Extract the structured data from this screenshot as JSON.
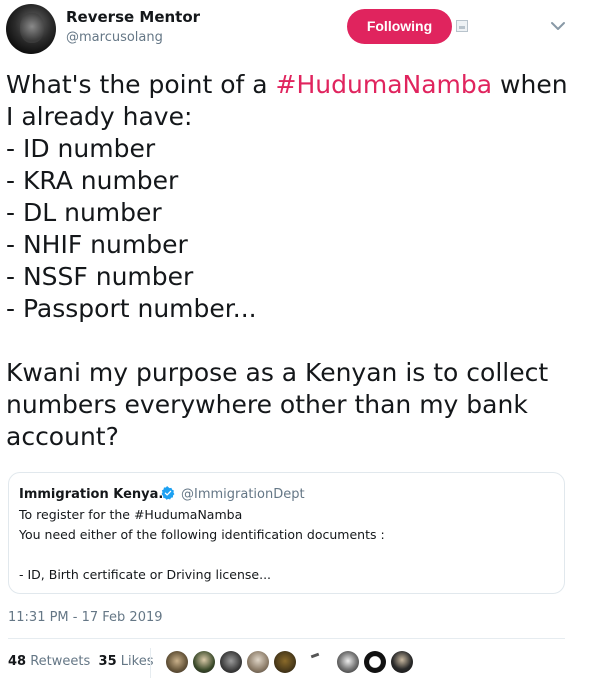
{
  "tweet": {
    "author": {
      "display_name": "Reverse Mentor",
      "handle": "@marcusolang"
    },
    "follow_button_label": "Following",
    "text_before": "What's the point of a ",
    "hashtag": "#HudumaNamba",
    "text_after": " when I already have:\n- ID number\n- KRA number\n- DL number\n- NHIF number\n- NSSF number\n- Passport number...\n\nKwani my purpose as a Kenyan is to collect numbers everywhere other than my bank account?",
    "quoted_tweet": {
      "author_name": "Immigration Kenya.",
      "author_handle": "@ImmigrationDept",
      "lines": [
        "To register for the #HudumaNamba",
        "You need either of the following identification documents :",
        "- ID, Birth certificate or Driving license..."
      ]
    },
    "timestamp": "11:31 PM - 17 Feb 2019",
    "stats": {
      "retweets_count": "48",
      "retweets_label": "Retweets",
      "likes_count": "35",
      "likes_label": "Likes"
    }
  },
  "icons": {
    "verified": "verified-badge-icon",
    "more": "chevron-down-icon",
    "image": "image-icon"
  },
  "colors": {
    "accent_pink": "#e0245e",
    "verified_blue": "#1da1f2",
    "secondary_text": "#657786",
    "border": "#e1e8ed"
  }
}
